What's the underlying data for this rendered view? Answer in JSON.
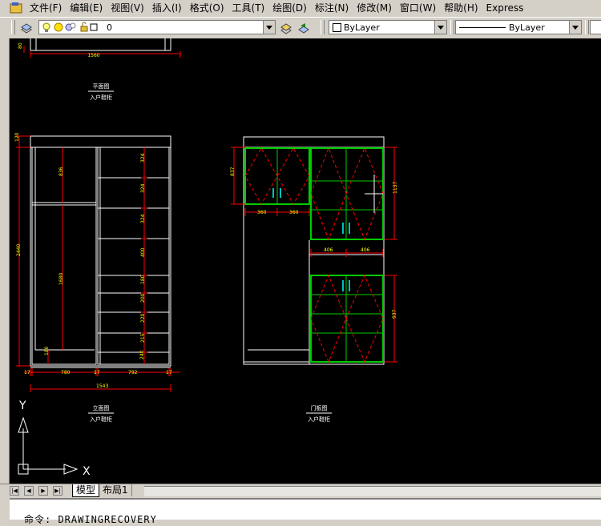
{
  "menu": [
    "文件(F)",
    "编辑(E)",
    "视图(V)",
    "插入(I)",
    "格式(O)",
    "工具(T)",
    "绘图(D)",
    "标注(N)",
    "修改(M)",
    "窗口(W)",
    "帮助(H)",
    "Express"
  ],
  "toolbar": {
    "layer_value": "0",
    "color_value": "ByLayer",
    "linetype_value": "ByLayer"
  },
  "drawing": {
    "top_dims": {
      "left": "80",
      "width": "1560"
    },
    "plan_title": "平面图",
    "plan_subtitle": "入户鞋柜",
    "elev_left_dims": {
      "top": "120",
      "height": "2440"
    },
    "elev_col1": {
      "upper": "836",
      "lower": "1680",
      "bottom": "180"
    },
    "elev_col2": [
      "324",
      "324",
      "324",
      "400",
      "180",
      "200",
      "220",
      "215",
      "240"
    ],
    "elev_bottom_dims": {
      "a": "17",
      "b": "780",
      "c": "17",
      "d": "792",
      "e": "17",
      "total": "1543"
    },
    "elev_title": "立面图",
    "elev_subtitle": "入户鞋柜",
    "door_dims": {
      "upper_left_h": "837",
      "w1": "360",
      "w2": "360",
      "upper_right_h": "1137",
      "w3": "406",
      "w4": "406",
      "lower_right_h": "937"
    },
    "door_title": "门板图",
    "door_subtitle": "入户鞋柜",
    "ucs": {
      "y": "Y",
      "x": "X"
    }
  },
  "tabs": {
    "model": "模型",
    "layout": "布局1"
  },
  "command": {
    "text": "命令: DRAWINGRECOVERY"
  },
  "colors": {
    "canvas": "#000000",
    "dimension": "#ff0000",
    "dim_text": "#ffff00",
    "door_panel": "#00c000",
    "outline": "#ffffff",
    "handle": "#00ffff"
  }
}
